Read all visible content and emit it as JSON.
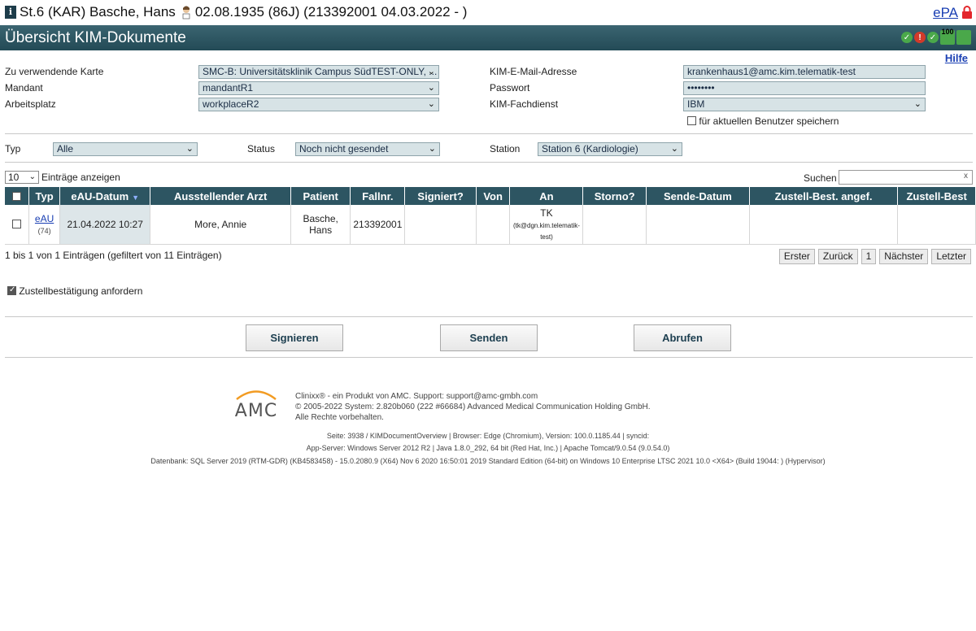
{
  "patient_header": {
    "text1": "St.6 (KAR) Basche, Hans",
    "text2": "02.08.1935 (86J) (213392001 04.03.2022 - )",
    "epa_link": "ePA"
  },
  "title_bar": {
    "title": "Übersicht KIM-Dokumente"
  },
  "help_link": "Hilfe",
  "form": {
    "karte_label": "Zu verwendende Karte",
    "karte_value": "SMC-B: Universitätsklinik Campus SüdTEST-ONLY, ...",
    "mandant_label": "Mandant",
    "mandant_value": "mandantR1",
    "arbeitsplatz_label": "Arbeitsplatz",
    "arbeitsplatz_value": "workplaceR2",
    "email_label": "KIM-E-Mail-Adresse",
    "email_value": "krankenhaus1@amc.kim.telematik-test",
    "passwort_label": "Passwort",
    "passwort_value": "••••••••",
    "fachdienst_label": "KIM-Fachdienst",
    "fachdienst_value": "IBM",
    "save_user_label": "für aktuellen Benutzer speichern"
  },
  "filters": {
    "typ_label": "Typ",
    "typ_value": "Alle",
    "status_label": "Status",
    "status_value": "Noch nicht gesendet",
    "station_label": "Station",
    "station_value": "Station 6 (Kardiologie)"
  },
  "table_controls": {
    "page_size": "10",
    "page_size_suffix": "Einträge anzeigen",
    "search_label": "Suchen",
    "search_clear": "x"
  },
  "table": {
    "columns": [
      "Typ",
      "eAU-Datum",
      "Ausstellender Arzt",
      "Patient",
      "Fallnr.",
      "Signiert?",
      "Von",
      "An",
      "Storno?",
      "Sende-Datum",
      "Zustell-Best. angef.",
      "Zustell-Best"
    ],
    "rows": [
      {
        "typ": "eAU",
        "typ_count": "(74)",
        "datum": "21.04.2022 10:27",
        "arzt": "More, Annie",
        "patient": "Basche, Hans",
        "fallnr": "213392001",
        "signiert": "",
        "von": "",
        "an_name": "TK",
        "an_email": "(tk@dgn.kim.telematik-test)",
        "storno": "",
        "sende_datum": "",
        "zustell_angef": "",
        "zustell_best": ""
      }
    ]
  },
  "table_info": "1 bis 1 von 1 Einträgen (gefiltert von 11 Einträgen)",
  "pager": {
    "first": "Erster",
    "prev": "Zurück",
    "page": "1",
    "next": "Nächster",
    "last": "Letzter"
  },
  "zustell_checkbox_label": "Zustellbestätigung anfordern",
  "actions": {
    "sign": "Signieren",
    "send": "Senden",
    "fetch": "Abrufen"
  },
  "footer": {
    "logo_text": "AMC",
    "line1": "Clinixx® - ein Produkt von AMC. Support: support@amc-gmbh.com",
    "line2": "© 2005-2022 System: 2.820b060 (222 #66684) Advanced Medical Communication Holding GmbH.",
    "line3": "Alle Rechte vorbehalten.",
    "sys1": "Seite: 3938 / KIMDocumentOverview | Browser: Edge (Chromium), Version: 100.0.1185.44 | syncid:",
    "sys2": "App-Server: Windows Server 2012 R2 | Java 1.8.0_292, 64 bit (Red Hat, Inc.) | Apache Tomcat/9.0.54 (9.0.54.0)",
    "sys3": "Datenbank: SQL Server 2019 (RTM-GDR) (KB4583458) - 15.0.2080.9 (X64) Nov 6 2020 16:50:01 2019 Standard Edition (64-bit) on Windows 10 Enterprise LTSC 2021 10.0 <X64> (Build 19044: ) (Hypervisor)"
  },
  "colors": {
    "header_bar": "#2d5562",
    "link": "#1a3fb3",
    "select_bg": "#d7e3e6"
  },
  "status_icons": [
    "check-circle-icon",
    "error-circle-icon",
    "check-circle-icon",
    "card-reader-100-icon",
    "card-icon"
  ]
}
